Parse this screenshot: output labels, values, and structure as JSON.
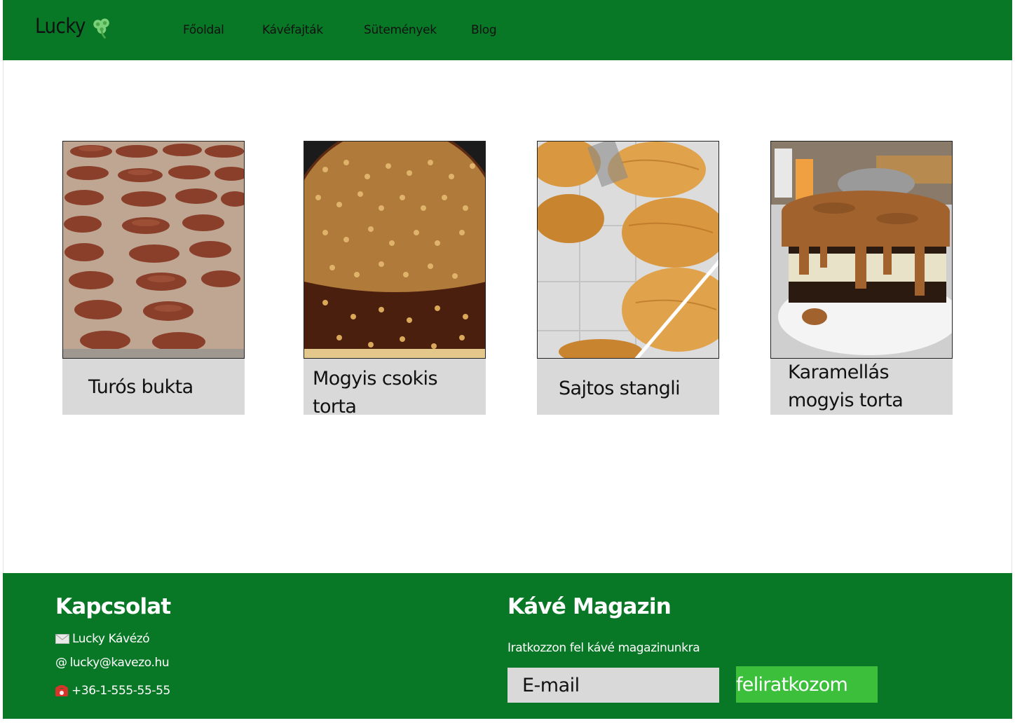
{
  "header": {
    "brand": "Lucky",
    "brand_icon": "shamrock-icon",
    "nav": [
      {
        "label": "Főoldal"
      },
      {
        "label": "Kávéfajták"
      },
      {
        "label": "Sütemények"
      },
      {
        "label": "Blog"
      }
    ]
  },
  "cakes": [
    {
      "name": "Turós bukta"
    },
    {
      "name": "Mogyis csokis torta"
    },
    {
      "name": "Sajtos stangli"
    },
    {
      "name": "Karamellás mogyis torta"
    }
  ],
  "footer": {
    "contact": {
      "title": "Kapcsolat",
      "name": "Lucky Kávézó",
      "email": "lucky@kavezo.hu",
      "phone": "+36-1-555-55-55",
      "icons": [
        "envelope-icon",
        "at-icon",
        "telephone-icon"
      ]
    },
    "magazine": {
      "title": "Kávé Magazin",
      "text": "Iratkozzon fel kávé magazinunkra",
      "email_placeholder": "E-mail",
      "button_label": "feliratkozom"
    }
  },
  "colors": {
    "brand_green": "#097826",
    "button_green": "#3cc03c",
    "caption_gray": "#d9d9d9"
  }
}
